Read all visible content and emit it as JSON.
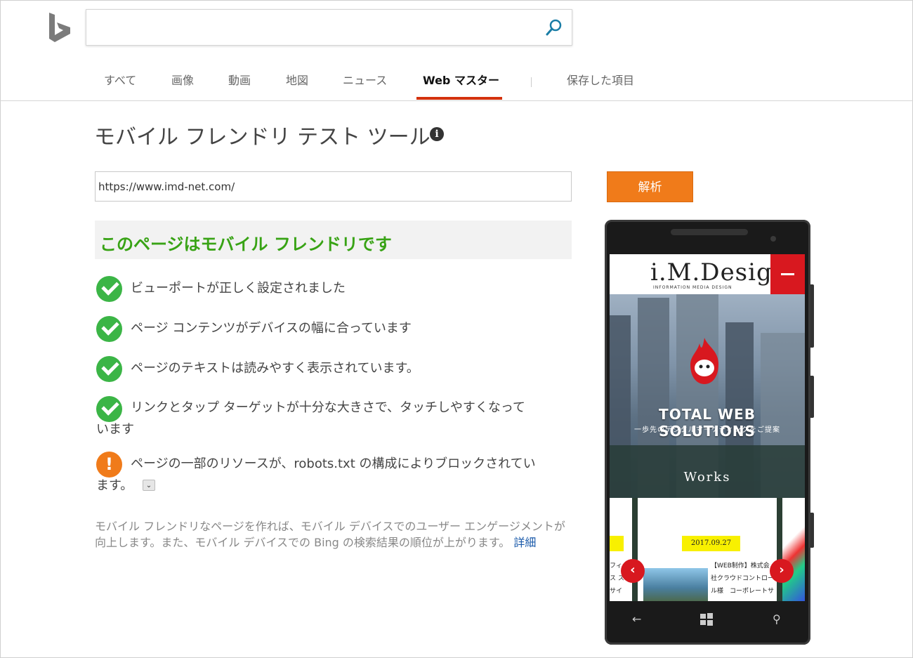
{
  "header": {
    "search_value": "",
    "tabs": [
      {
        "label": "すべて"
      },
      {
        "label": "画像"
      },
      {
        "label": "動画"
      },
      {
        "label": "地図"
      },
      {
        "label": "ニュース"
      },
      {
        "label": "Web マスター",
        "active": true
      },
      {
        "label": "保存した項目"
      }
    ]
  },
  "main": {
    "title": "モバイル フレンドリ テスト ツール",
    "info_icon": "i",
    "url_value": "https://www.imd-net.com/",
    "analyze_label": "解析",
    "result_banner": "このページはモバイル フレンドリです",
    "checks": [
      {
        "status": "pass",
        "line1": "ビューポートが正しく設定されました"
      },
      {
        "status": "pass",
        "line1": "ページ コンテンツがデバイスの幅に合っています"
      },
      {
        "status": "pass",
        "line1": "ページのテキストは読みやすく表示されています。"
      },
      {
        "status": "pass",
        "line1": "リンクとタップ ターゲットが十分な大きさで、タッチしやすくなって",
        "line2": "います"
      },
      {
        "status": "warning",
        "line1": "ページの一部のリソースが、robots.txt の構成によりブロックされてい",
        "line2": "ます。"
      }
    ],
    "warning_glyph": "!",
    "expand_glyph": "⌄",
    "footer_text": "モバイル フレンドリなページを作れば、モバイル デバイスでのユーザー エンゲージメントが向上します。また、モバイル デバイスでの Bing の検索結果の順位が上がります。",
    "footer_link": "詳細"
  },
  "phone_preview": {
    "site_logo": "i.M.Design",
    "site_logo_sub": "INFORMATION MEDIA DESIGN",
    "hero_title": "TOTAL WEB SOLUTIONS",
    "hero_subtitle": "一歩先のデジタルマーケティングをご提案",
    "works_label": "Works",
    "card_date": "2017.09.27",
    "card_text_1": "【WEB制作】株式会",
    "card_text_2": "社クラウドコントロー",
    "card_text_3": "ル様　コーポレートサ",
    "left_card_1": "フィ",
    "left_card_2": "ス ス",
    "left_card_3": "サイ",
    "prev_glyph": "‹",
    "next_glyph": "›",
    "nav_back": "←",
    "nav_search": "⚲"
  },
  "colors": {
    "accent_tab": "#d4320d",
    "analyze_button": "#f07b1a",
    "pass_green": "#3bb546",
    "warning_orange": "#f07b1a",
    "link_blue": "#1a5aaa"
  }
}
